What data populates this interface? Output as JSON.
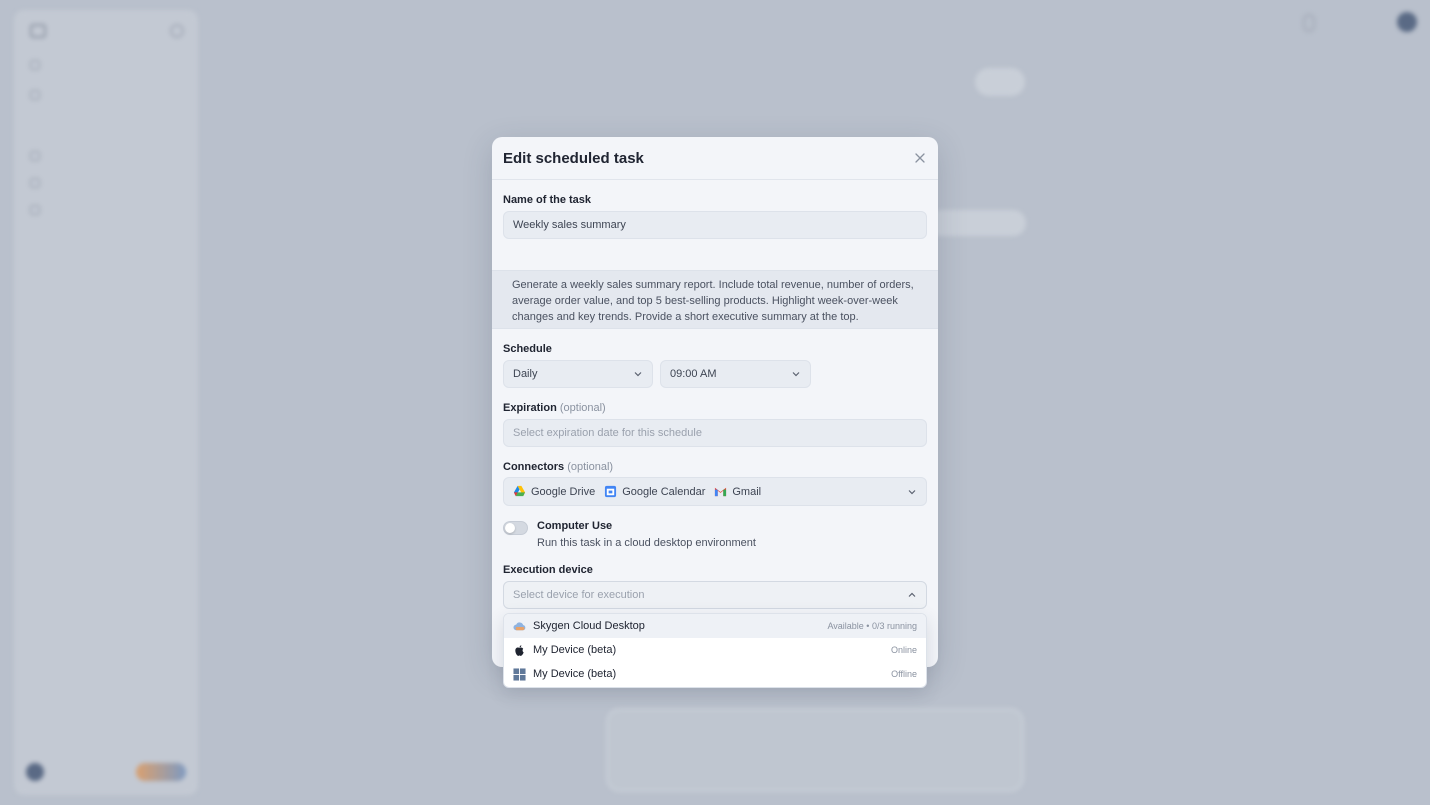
{
  "modal": {
    "title": "Edit scheduled task",
    "name_label": "Name of the task",
    "name_value": "Weekly sales summary",
    "prompt": "Generate a weekly sales summary report. Include total revenue, number of orders, average order value, and top 5 best-selling products. Highlight week-over-week changes and key trends. Provide a short executive summary at the top.",
    "schedule_label": "Schedule",
    "frequency": "Daily",
    "time": "09:00 AM",
    "expiration_label": "Expiration",
    "optional": "(optional)",
    "expiration_placeholder": "Select expiration date for this schedule",
    "connectors_label": "Connectors",
    "connectors": [
      {
        "name": "Google Drive",
        "icon": "google-drive-icon"
      },
      {
        "name": "Google Calendar",
        "icon": "google-calendar-icon"
      },
      {
        "name": "Gmail",
        "icon": "gmail-icon"
      }
    ],
    "computer_use_title": "Computer Use",
    "computer_use_desc": "Run this task in a cloud desktop environment",
    "computer_use_enabled": false,
    "device_label": "Execution device",
    "device_placeholder": "Select device for execution"
  },
  "devices": [
    {
      "name": "Skygen Cloud Desktop",
      "status": "Available  •  0/3 running",
      "icon": "cloud-icon"
    },
    {
      "name": "My Device (beta)",
      "status": "Online",
      "icon": "apple-icon"
    },
    {
      "name": "My Device (beta)",
      "status": "Offline",
      "icon": "windows-icon"
    }
  ],
  "colors": {
    "overlay": "#b9c0cc",
    "modal_bg": "#f3f5f9",
    "field_bg": "#e8ecf2",
    "text": "#202532"
  }
}
